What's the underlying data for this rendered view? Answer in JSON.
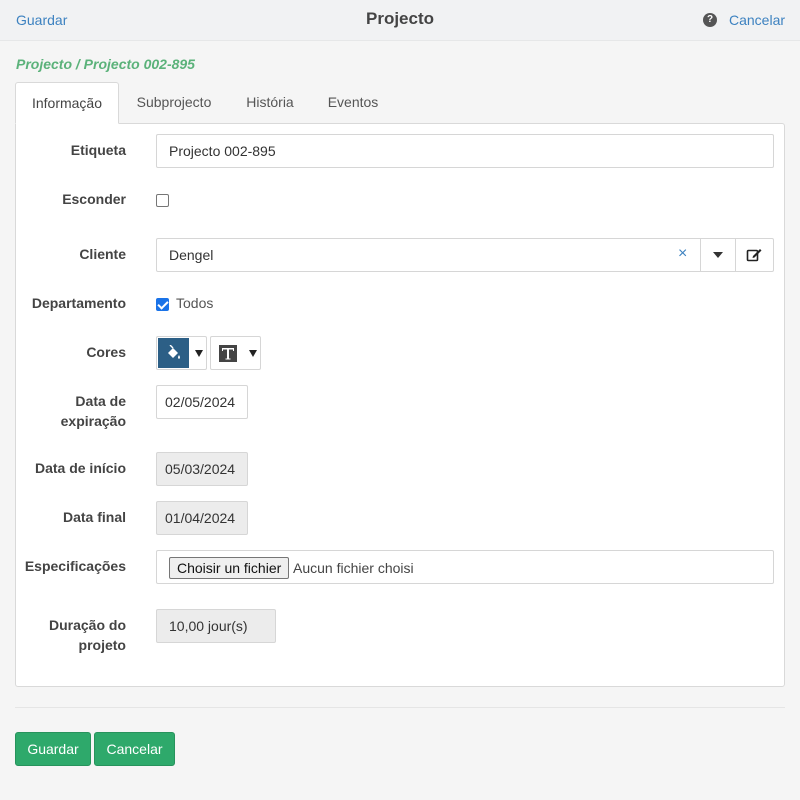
{
  "header": {
    "save_label": "Guardar",
    "title": "Projecto",
    "help_icon": "question-circle-icon",
    "cancel_label": "Cancelar"
  },
  "breadcrumb": "Projecto / Projecto 002-895",
  "tabs": [
    {
      "label": "Informação",
      "active": true
    },
    {
      "label": "Subprojecto",
      "active": false
    },
    {
      "label": "História",
      "active": false
    },
    {
      "label": "Eventos",
      "active": false
    }
  ],
  "form": {
    "etiqueta": {
      "label": "Etiqueta",
      "value": "Projecto 002-895"
    },
    "esconder": {
      "label": "Esconder",
      "checked": false
    },
    "cliente": {
      "label": "Cliente",
      "value": "Dengel",
      "clear_icon": "×"
    },
    "departamento": {
      "label": "Departamento",
      "checked": true,
      "option_label": "Todos"
    },
    "cores": {
      "label": "Cores",
      "background_color": "#2c5f86",
      "text_color": "#444444"
    },
    "data_expiracao": {
      "label_line1": "Data de",
      "label_line2": "expiração",
      "value": "02/05/2024"
    },
    "data_inicio": {
      "label": "Data de início",
      "value": "05/03/2024"
    },
    "data_final": {
      "label": "Data final",
      "value": "01/04/2024"
    },
    "especificacoes": {
      "label": "Especificações",
      "button_label": "Choisir un fichier",
      "status": "Aucun fichier choisi"
    },
    "duracao": {
      "label_line1": "Duração do",
      "label_line2": "projeto",
      "value": "10,00 jour(s)"
    }
  },
  "footer": {
    "save_label": "Guardar",
    "cancel_label": "Cancelar"
  },
  "colors": {
    "link": "#3d82c0",
    "breadcrumb": "#5bb27a",
    "button_green": "#2ea96b"
  }
}
